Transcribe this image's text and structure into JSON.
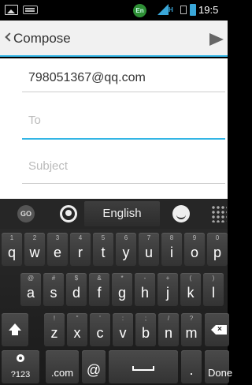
{
  "status_bar": {
    "time": "19:5",
    "input_indicator": "En",
    "network": "H"
  },
  "header": {
    "title": "Compose"
  },
  "compose": {
    "from": "798051367@qq.com",
    "to_placeholder": "To",
    "subject_placeholder": "Subject"
  },
  "keyboard": {
    "language": "English",
    "go_label": "GO",
    "row1": [
      {
        "ch": "q",
        "hint": "1"
      },
      {
        "ch": "w",
        "hint": "2"
      },
      {
        "ch": "e",
        "hint": "3"
      },
      {
        "ch": "r",
        "hint": "4"
      },
      {
        "ch": "t",
        "hint": "5"
      },
      {
        "ch": "y",
        "hint": "6"
      },
      {
        "ch": "u",
        "hint": "7"
      },
      {
        "ch": "i",
        "hint": "8"
      },
      {
        "ch": "o",
        "hint": "9"
      },
      {
        "ch": "p",
        "hint": "0"
      }
    ],
    "row2": [
      {
        "ch": "a",
        "hint": "@"
      },
      {
        "ch": "s",
        "hint": "#"
      },
      {
        "ch": "d",
        "hint": "$"
      },
      {
        "ch": "f",
        "hint": "&"
      },
      {
        "ch": "g",
        "hint": "*"
      },
      {
        "ch": "h",
        "hint": "-"
      },
      {
        "ch": "j",
        "hint": "+"
      },
      {
        "ch": "k",
        "hint": "("
      },
      {
        "ch": "l",
        "hint": ")"
      }
    ],
    "row3": [
      {
        "ch": "z",
        "hint": "!"
      },
      {
        "ch": "x",
        "hint": "\""
      },
      {
        "ch": "c",
        "hint": "'"
      },
      {
        "ch": "v",
        "hint": ":"
      },
      {
        "ch": "b",
        "hint": ";"
      },
      {
        "ch": "n",
        "hint": "/"
      },
      {
        "ch": "m",
        "hint": "?"
      }
    ],
    "sym_label": "?123",
    "dotcom_label": ".com",
    "at_label": "@",
    "period_label": ".",
    "done_label": "Done"
  }
}
